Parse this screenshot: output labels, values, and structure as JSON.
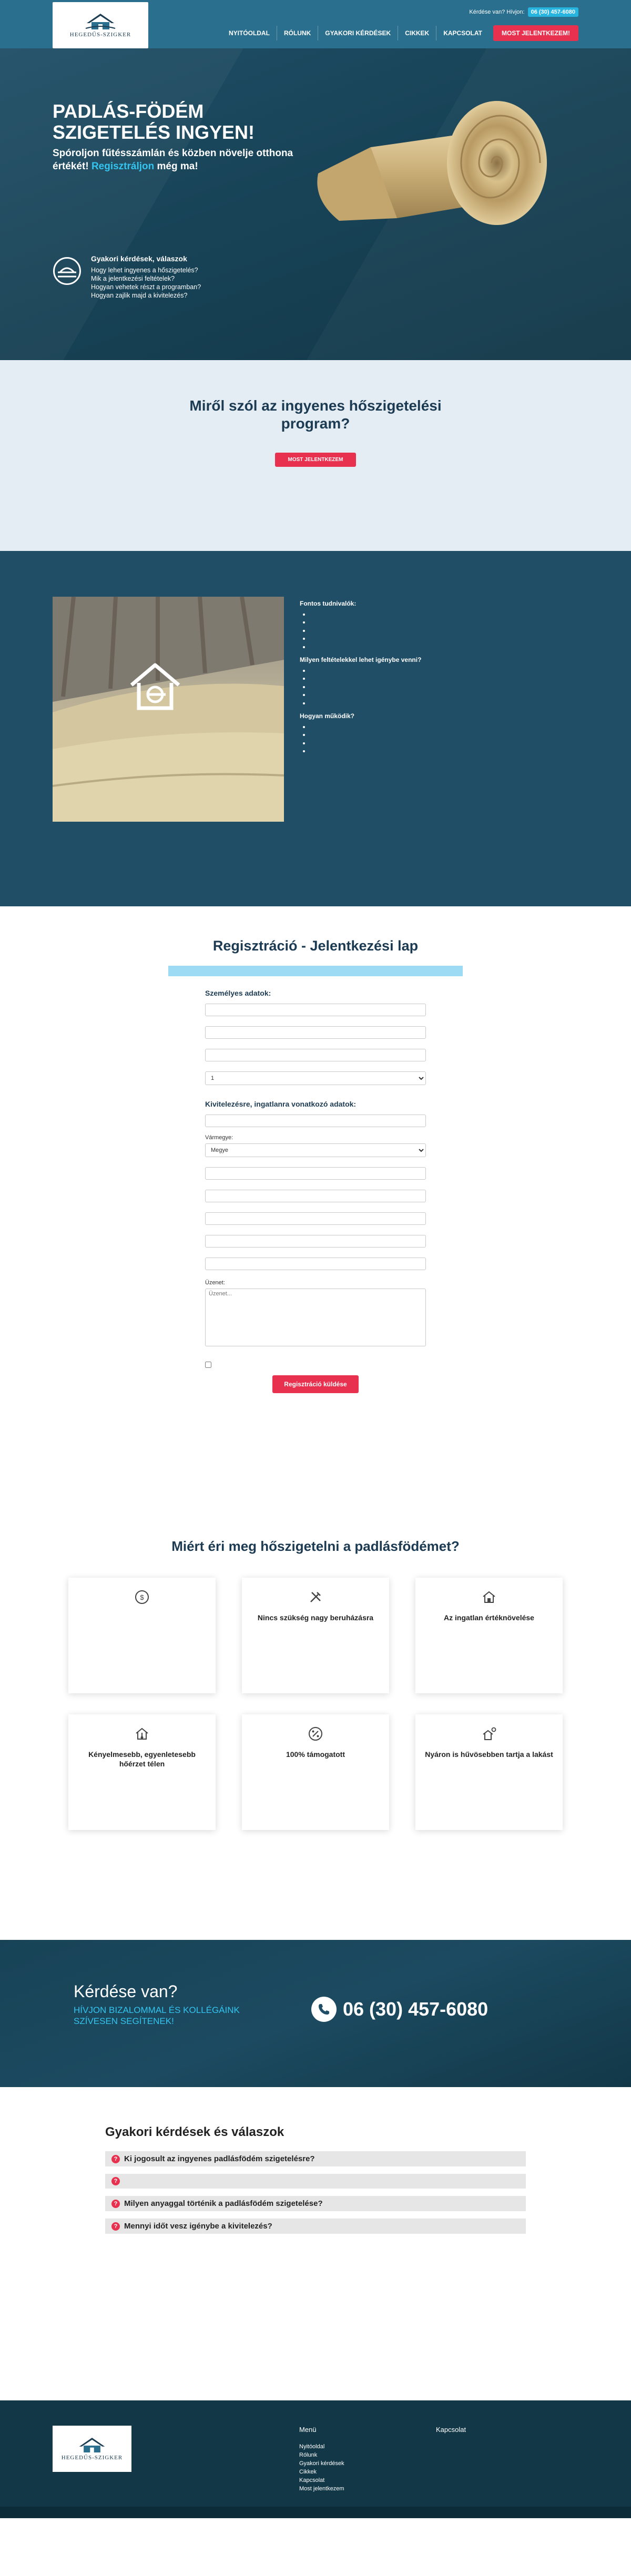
{
  "header": {
    "logo_name": "HEGEDŰS-SZIGKER",
    "logo_sub": "",
    "top_question": "Kérdése van? Hívjon:",
    "top_phone": "06 (30) 457-6080",
    "nav": [
      "Nyitóoldal",
      "Rólunk",
      "Gyakori kérdések",
      "Cikkek",
      "Kapcsolat"
    ],
    "cta": "Most jelentkezem!"
  },
  "hero": {
    "title": "Padlás-födém szigetelés ingyen!",
    "subtitle_before": "Spóroljon fűtésszámlán és közben növelje otthona értékét!",
    "subtitle_highlight": "Regisztráljon",
    "subtitle_after": "még ma!",
    "small": "",
    "faq_title": "Gyakori kérdések, válaszok",
    "faq_items": [
      "Hogy lehet ingyenes a hőszigetelés?",
      "Mik a jelentkezési feltételek?",
      "Hogyan vehetek részt a programban?",
      "Hogyan zajlik majd a kivitelezés?"
    ]
  },
  "intro": {
    "title": "Miről szól az ingyenes hőszigetelési program?",
    "p1_bold": "",
    "p1": "",
    "p2": "",
    "cta": "Most jelentkezem"
  },
  "details": {
    "h1": "Fontos tudnivalók:",
    "list1": [
      "",
      "",
      "",
      "",
      ""
    ],
    "h2": "Milyen feltételekkel lehet igénybe venni?",
    "list2": [
      "",
      "",
      "",
      "",
      ""
    ],
    "h3": "Hogyan működik?",
    "list3": [
      "",
      "",
      "",
      ""
    ]
  },
  "registration": {
    "title": "Regisztráció - Jelentkezési lap",
    "info": "",
    "section1": "Személyes adatok:",
    "fields1": [
      "",
      "",
      "",
      ""
    ],
    "count_default": "1",
    "section2": "Kivitelezésre, ingatlanra vonatkozó adatok:",
    "field_insulation": "",
    "field_county": "Vármegye:",
    "county_default": "Megye",
    "fields2": [
      "",
      "",
      "",
      "",
      "",
      ""
    ],
    "note": "",
    "field_message": "Üzenet:",
    "message_placeholder": "Üzenet...",
    "consent": "",
    "submit": "Regisztráció küldése"
  },
  "why": {
    "title": "Miért éri meg hőszigetelni a padlásfödémet?",
    "lead": "",
    "cards": [
      {
        "title": "",
        "text": "",
        "icon": "coin-icon"
      },
      {
        "title": "Nincs szükség nagy beruházásra",
        "text": "",
        "icon": "tools-icon"
      },
      {
        "title": "Az ingatlan értéknövelése",
        "text": "",
        "icon": "house-icon"
      },
      {
        "title": "Kényelmesebb, egyenletesebb hőérzet télen",
        "text": "",
        "icon": "thermometer-icon"
      },
      {
        "title": "100% támogatott",
        "text": "",
        "icon": "percent-icon"
      },
      {
        "title": "Nyáron is hűvösebben tartja a lakást",
        "text": "",
        "icon": "sun-house-icon"
      }
    ]
  },
  "contact": {
    "title": "Kérdése van?",
    "sub1": "Hívjon bizalommal és kollégáink",
    "sub2": "szívesen segítenek!",
    "phone": "06 (30) 457-6080"
  },
  "faq": {
    "title": "Gyakori kérdések és válaszok",
    "subtitle": "",
    "meta": "",
    "items": [
      {
        "q": "Ki jogosult az ingyenes padlásfödém szigetelésre?",
        "a": ""
      },
      {
        "q": "",
        "a": ""
      },
      {
        "q": "Milyen anyaggal történik a padlásfödém szigetelése?",
        "a": ""
      },
      {
        "q": "Mennyi időt vesz igénybe a kivitelezés?",
        "a": ""
      }
    ]
  },
  "footer": {
    "text_bold": "",
    "text_link": "",
    "menu_title": "Menü",
    "menu": [
      "Nyitóoldal",
      "Rólunk",
      "Gyakori kérdések",
      "Cikkek",
      "Kapcsolat",
      "Most jelentkezem"
    ],
    "contact_title": "Kapcsolat",
    "contact": [
      "",
      "",
      "",
      "",
      ""
    ],
    "copyright": ""
  },
  "colors": {
    "primary": "#2a6f8e",
    "dark": "#123848",
    "accent": "#e8304f",
    "cyan": "#33c4f0"
  }
}
